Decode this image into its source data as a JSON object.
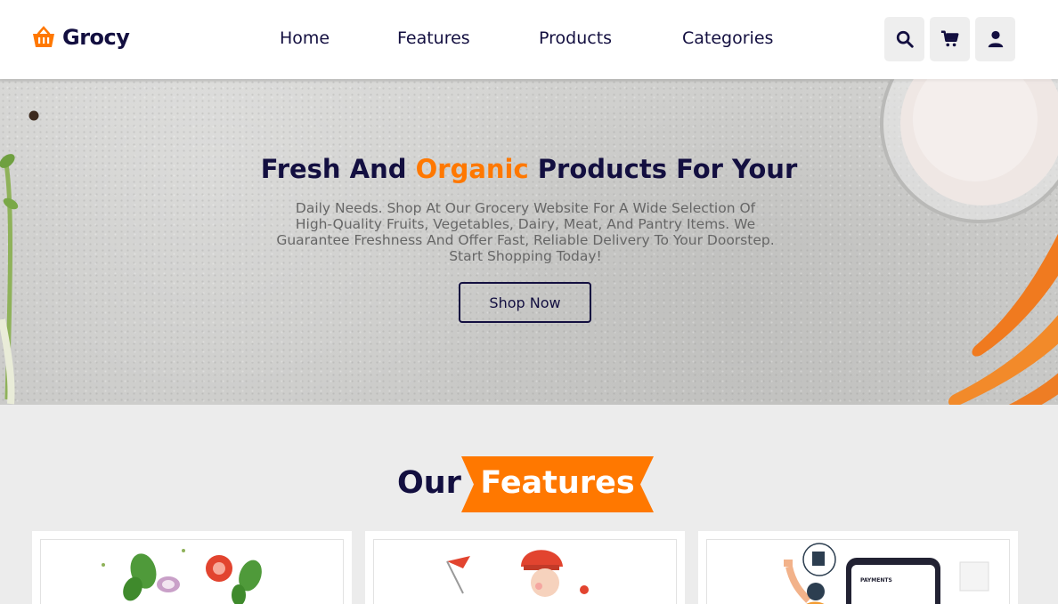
{
  "brand": {
    "name": "Grocy",
    "icon": "basket-icon",
    "accent_color": "#ff7800",
    "primary_color": "#130f40"
  },
  "nav": [
    {
      "label": "Home"
    },
    {
      "label": "Features"
    },
    {
      "label": "Products"
    },
    {
      "label": "Categories"
    }
  ],
  "header_icons": [
    "search-icon",
    "cart-icon",
    "user-icon"
  ],
  "hero": {
    "title_before": "Fresh And ",
    "title_accent": "Organic",
    "title_after": " Products For Your",
    "description": "Daily Needs. Shop At Our Grocery Website For A Wide Selection Of High-Quality Fruits, Vegetables, Dairy, Meat, And Pantry Items. We Guarantee Freshness And Offer Fast, Reliable Delivery To Your Doorstep. Start Shopping Today!",
    "cta_label": "Shop Now"
  },
  "features": {
    "title_plain": "Our",
    "title_highlight": "Features",
    "cards": [
      {
        "image": "fresh-vegetables-illustration"
      },
      {
        "image": "delivery-courier-illustration"
      },
      {
        "image": "mobile-payment-illustration",
        "image_text": "PAYMENTS"
      }
    ]
  }
}
